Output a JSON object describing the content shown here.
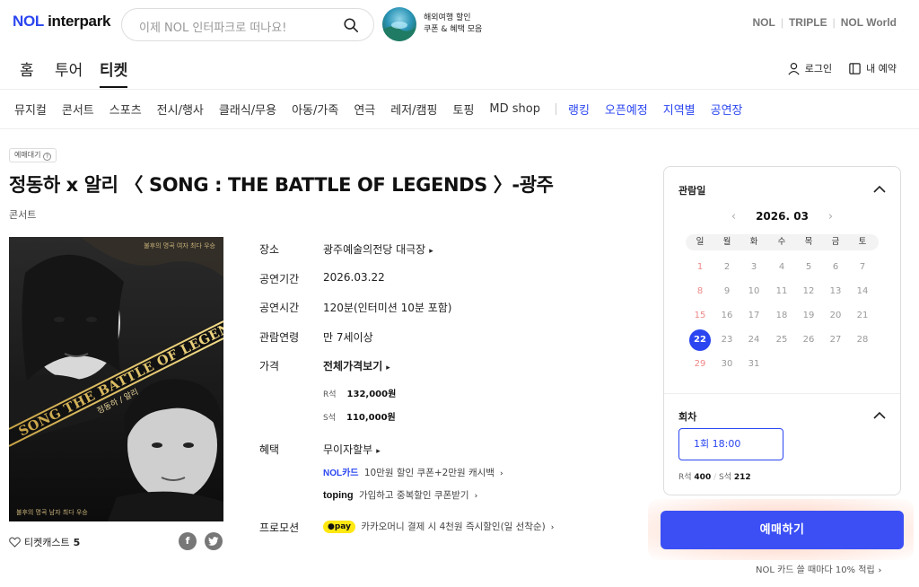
{
  "header": {
    "logo_prefix": "NOL",
    "logo_suffix": " interpark",
    "search_placeholder": "이제 NOL 인터파크로 떠나요!",
    "promo_line1": "해외여행 할인",
    "promo_line2": "쿠폰 & 혜택 모음",
    "brands": [
      "NOL",
      "TRIPLE",
      "NOL World"
    ]
  },
  "main_tabs": [
    "홈",
    "투어",
    "티켓"
  ],
  "util": {
    "login": "로그인",
    "my_booking": "내 예약"
  },
  "categories": [
    "뮤지컬",
    "콘서트",
    "스포츠",
    "전시/행사",
    "클래식/무용",
    "아동/가족",
    "연극",
    "레저/캠핑",
    "토핑",
    "MD shop"
  ],
  "categories_highlight": [
    "랭킹",
    "오픈예정",
    "지역별",
    "공연장"
  ],
  "product": {
    "badge": "예매대기",
    "title": "정동하 x 알리 〈 SONG : THE BATTLE OF LEGENDS 〉-광주",
    "genre": "콘서트",
    "likes_label": "티켓캐스트",
    "likes_count": "5"
  },
  "poster": {
    "top_caption": "불후의 명곡 여자 최다 우승",
    "diagonal_title": "SONG THE BATTLE OF LEGENDS",
    "names": "정동하 / 알리",
    "bottom_caption": "불후의 명곡 남자 최다 우승"
  },
  "info": {
    "venue_label": "장소",
    "venue_value": "광주예술의전당 대극장",
    "period_label": "공연기간",
    "period_value": "2026.03.22",
    "runtime_label": "공연시간",
    "runtime_value": "120분(인터미션 10분 포함)",
    "age_label": "관람연령",
    "age_value": "만 7세이상",
    "price_label": "가격",
    "price_value": "전체가격보기",
    "prices": [
      {
        "seat": "R석",
        "price": "132,000원"
      },
      {
        "seat": "S석",
        "price": "110,000원"
      }
    ],
    "benefit_label": "혜택",
    "benefit_value": "무이자할부",
    "benefit_nol_brand": "NOL카드",
    "benefit_nol_text": "10만원 할인 쿠폰+2만원 캐시백",
    "benefit_toping_brand": "toping",
    "benefit_toping_text": "가입하고 중복할인 쿠폰받기",
    "promo_label": "프로모션",
    "promo_brand": "pay",
    "promo_text": "카카오머니 결제 시 4천원 즉시할인(일 선착순)"
  },
  "calendar": {
    "heading": "관람일",
    "month": "2026. 03",
    "weekdays": [
      "일",
      "월",
      "화",
      "수",
      "목",
      "금",
      "토"
    ],
    "weeks": [
      [
        "1",
        "2",
        "3",
        "4",
        "5",
        "6",
        "7"
      ],
      [
        "8",
        "9",
        "10",
        "11",
        "12",
        "13",
        "14"
      ],
      [
        "15",
        "16",
        "17",
        "18",
        "19",
        "20",
        "21"
      ],
      [
        "22",
        "23",
        "24",
        "25",
        "26",
        "27",
        "28"
      ],
      [
        "29",
        "30",
        "31"
      ]
    ],
    "selected_day": "22",
    "session_heading": "회차",
    "session_value": "1회 18:00",
    "seat_r_label": "R석",
    "seat_r_count": "400",
    "seat_s_label": "S석",
    "seat_s_count": "212"
  },
  "booking": {
    "button": "예매하기",
    "earn_note": "NOL 카드 쓸 때마다 10% 적립"
  },
  "colors": {
    "accent": "#2b46f0",
    "book_button": "#3b4ff5",
    "sunday": "#e88888"
  }
}
